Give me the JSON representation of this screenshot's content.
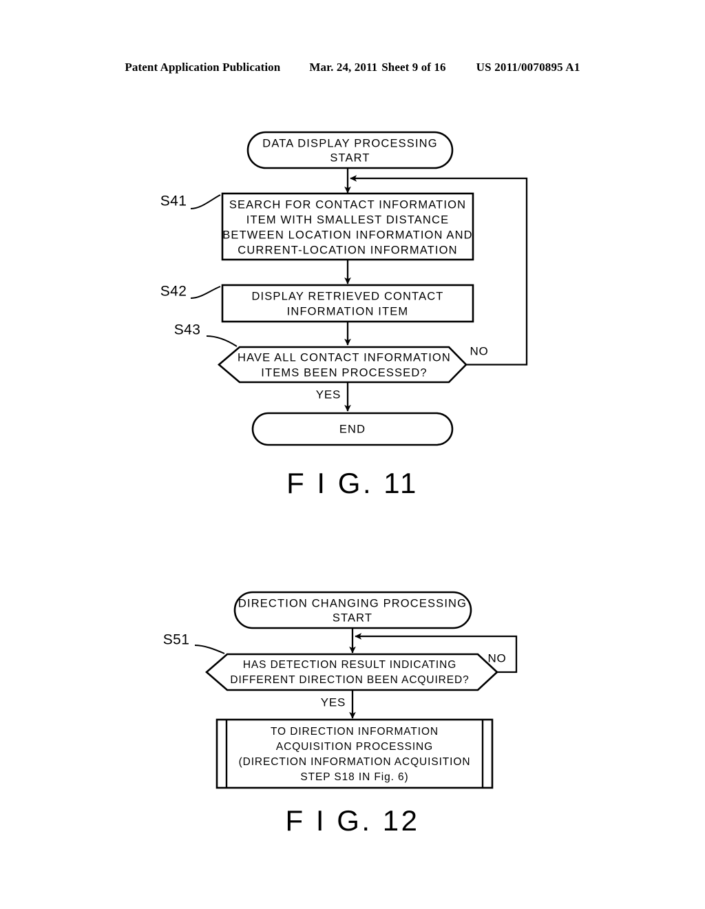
{
  "header": {
    "publication": "Patent Application Publication",
    "date": "Mar. 24, 2011",
    "sheet": "Sheet 9 of 16",
    "document_number": "US 2011/0070895 A1"
  },
  "figures": [
    {
      "id": "fig-11",
      "caption": "F I G. 11",
      "nodes": {
        "start": {
          "type": "terminator",
          "lines": [
            "DATA DISPLAY PROCESSING",
            "START"
          ]
        },
        "s41": {
          "type": "process",
          "step_label": "S41",
          "lines": [
            "SEARCH FOR CONTACT INFORMATION",
            "ITEM WITH SMALLEST DISTANCE",
            "BETWEEN LOCATION INFORMATION AND",
            "CURRENT-LOCATION INFORMATION"
          ]
        },
        "s42": {
          "type": "process",
          "step_label": "S42",
          "lines": [
            "DISPLAY RETRIEVED CONTACT",
            "INFORMATION ITEM"
          ]
        },
        "s43": {
          "type": "decision",
          "step_label": "S43",
          "lines": [
            "HAVE ALL CONTACT INFORMATION",
            "ITEMS BEEN PROCESSED?"
          ],
          "branch_no": "NO",
          "branch_yes": "YES"
        },
        "end": {
          "type": "terminator",
          "lines": [
            "END"
          ]
        }
      }
    },
    {
      "id": "fig-12",
      "caption": "F I G. 12",
      "nodes": {
        "start": {
          "type": "terminator",
          "lines": [
            "DIRECTION CHANGING PROCESSING",
            "START"
          ]
        },
        "s51": {
          "type": "decision",
          "step_label": "S51",
          "lines": [
            "HAS DETECTION RESULT INDICATING",
            "DIFFERENT DIRECTION BEEN ACQUIRED?"
          ],
          "branch_no": "NO",
          "branch_yes": "YES"
        },
        "goto": {
          "type": "predefined-process",
          "lines": [
            "TO DIRECTION INFORMATION",
            "ACQUISITION PROCESSING",
            "(DIRECTION INFORMATION ACQUISITION",
            "STEP S18 IN Fig. 6)"
          ]
        }
      }
    }
  ]
}
